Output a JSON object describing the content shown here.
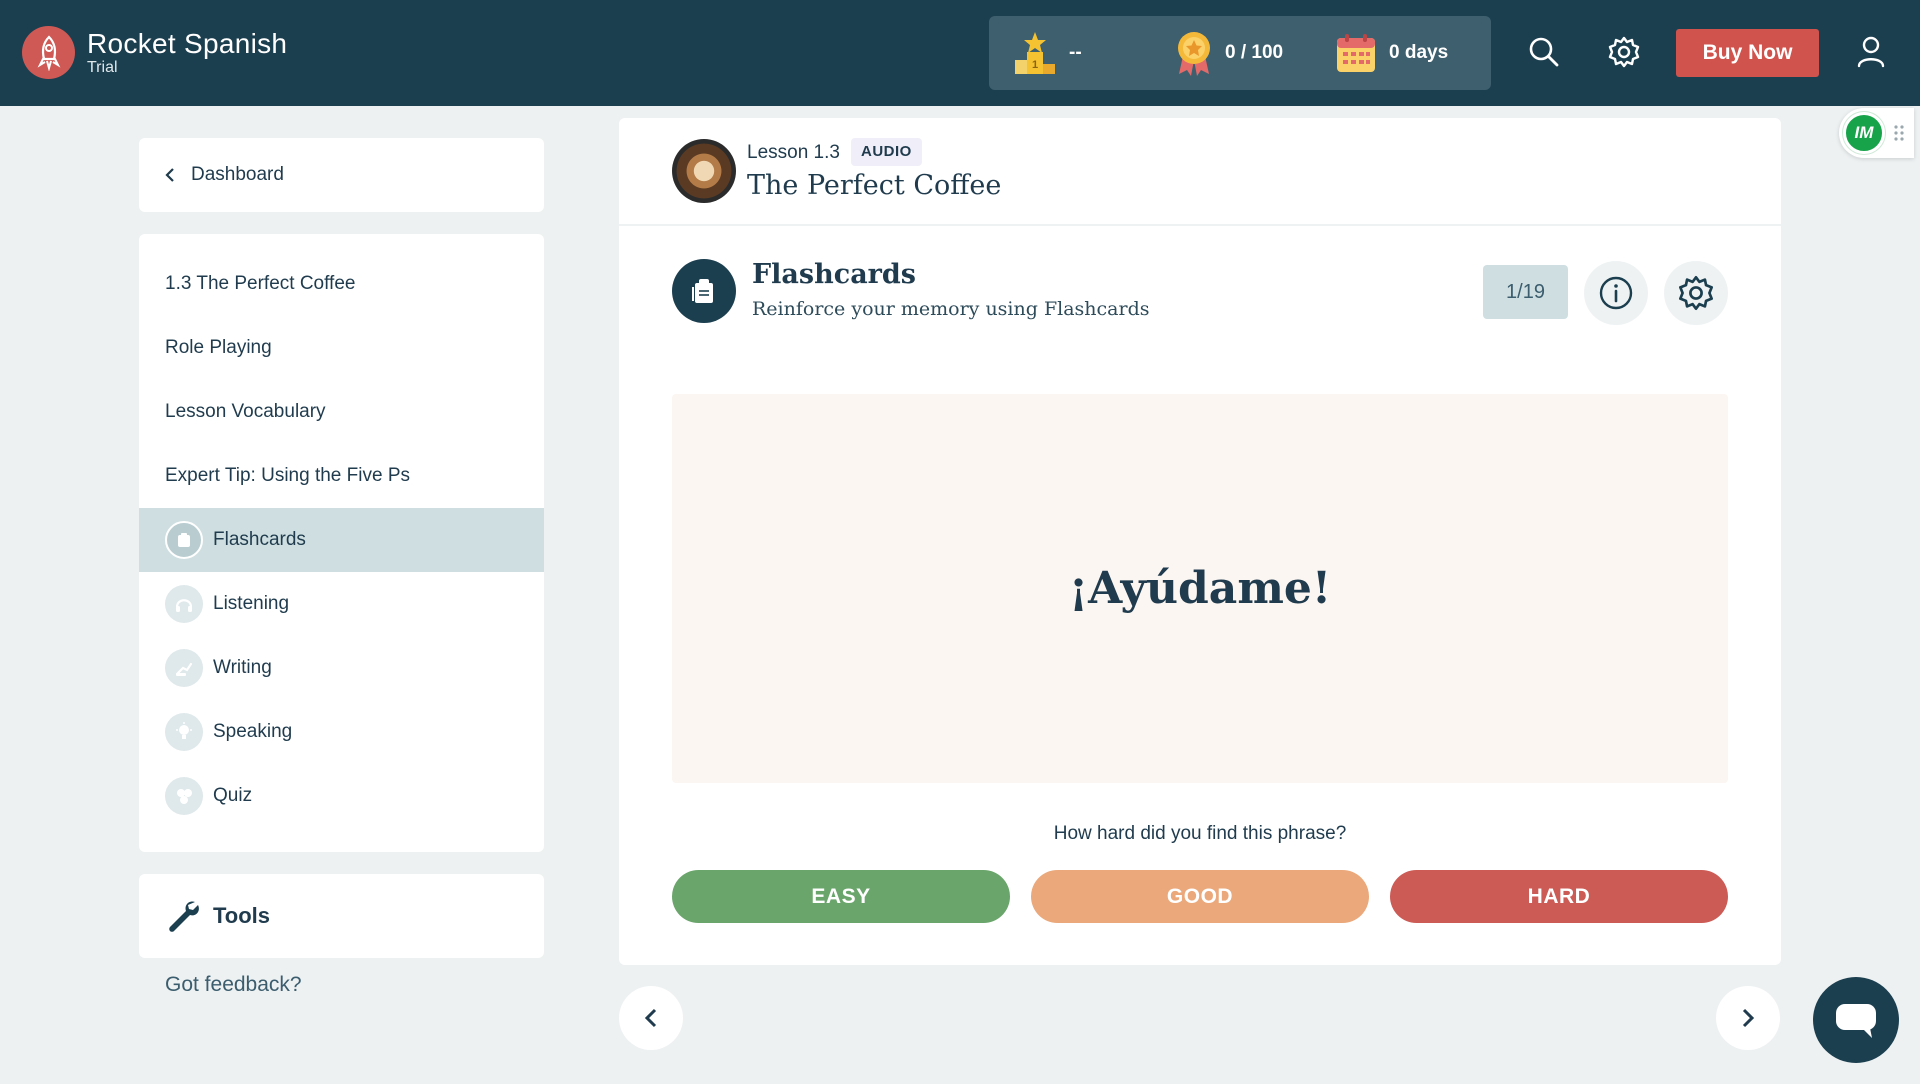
{
  "app": {
    "name": "Rocket Spanish",
    "plan": "Trial"
  },
  "header": {
    "leaderboard": {
      "value": "--",
      "icon": "podium-icon"
    },
    "points": {
      "value": "0 / 100",
      "icon": "medal-icon"
    },
    "streak": {
      "value": "0 days",
      "icon": "calendar-icon"
    },
    "buy_label": "Buy Now"
  },
  "sidebar": {
    "dashboard_label": "Dashboard",
    "lesson_items": [
      {
        "label": "1.3 The Perfect Coffee"
      },
      {
        "label": "Role Playing"
      },
      {
        "label": "Lesson Vocabulary"
      },
      {
        "label": "Expert Tip: Using the Five Ps"
      }
    ],
    "activities": [
      {
        "label": "Flashcards",
        "icon": "flashcards-icon",
        "active": true
      },
      {
        "label": "Listening",
        "icon": "headphones-icon",
        "active": false
      },
      {
        "label": "Writing",
        "icon": "writing-hand-icon",
        "active": false
      },
      {
        "label": "Speaking",
        "icon": "lightbulb-icon",
        "active": false
      },
      {
        "label": "Quiz",
        "icon": "quiz-icon",
        "active": false
      }
    ],
    "tools_label": "Tools",
    "feedback_label": "Got feedback?"
  },
  "lesson": {
    "number": "Lesson 1.3",
    "tag": "AUDIO",
    "title": "The Perfect Coffee"
  },
  "activity": {
    "title": "Flashcards",
    "subtitle": "Reinforce your memory using Flashcards",
    "counter": "1/19",
    "card_phrase": "¡Ayúdame!",
    "question": "How hard did you find this phrase?",
    "ratings": [
      {
        "label": "EASY",
        "color": "#6aa56b"
      },
      {
        "label": "GOOD",
        "color": "#eaa87b"
      },
      {
        "label": "HARD",
        "color": "#cc5a55"
      }
    ]
  },
  "extension": {
    "badge": "IM"
  },
  "colors": {
    "header_bg": "#1c3f50",
    "accent_red": "#d0534d",
    "active_nav": "#cfdfe1",
    "card_bg": "#fcf6f2"
  }
}
